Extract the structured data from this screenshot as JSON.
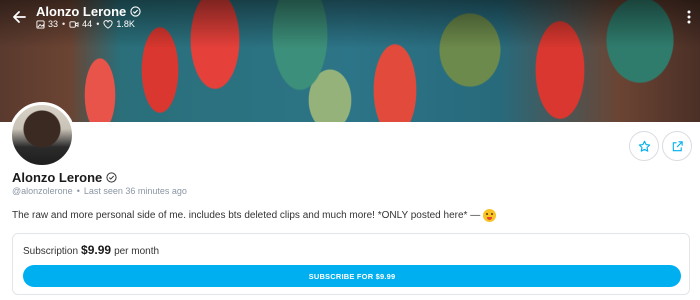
{
  "header": {
    "title": "Alonzo Lerone",
    "stats": {
      "posts": "33",
      "videos": "44",
      "likes": "1.8K"
    }
  },
  "profile": {
    "name": "Alonzo Lerone",
    "handle": "@alonzolerone",
    "last_seen": "Last seen 36 minutes ago",
    "bio": "The raw and more personal side of me. includes bts deleted clips and much more! *ONLY posted here* —"
  },
  "subscription": {
    "label": "Subscription",
    "price": "$9.99",
    "period": "per month",
    "button_label": "SUBSCRIBE FOR $9.99"
  },
  "colors": {
    "accent": "#00aff0"
  }
}
